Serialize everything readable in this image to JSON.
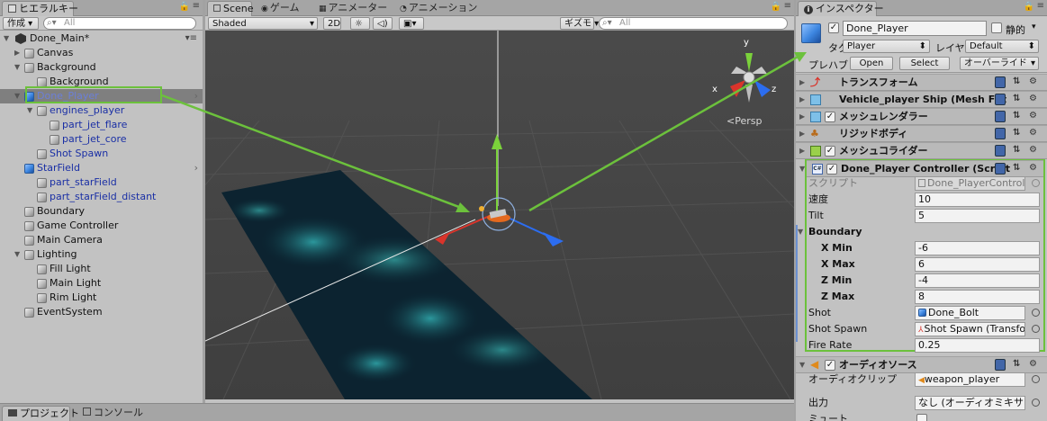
{
  "hierarchy": {
    "tab_label": "ヒエラルキー",
    "create_label": "作成 ▾",
    "search_placeholder": "All",
    "scene_name": "Done_Main*",
    "items": [
      {
        "label": "Canvas"
      },
      {
        "label": "Background"
      },
      {
        "label": "Background"
      },
      {
        "label": "Done_Player"
      },
      {
        "label": "engines_player"
      },
      {
        "label": "part_jet_flare"
      },
      {
        "label": "part_jet_core"
      },
      {
        "label": "Shot Spawn"
      },
      {
        "label": "StarField"
      },
      {
        "label": "part_starField"
      },
      {
        "label": "part_starField_distant"
      },
      {
        "label": "Boundary"
      },
      {
        "label": "Game Controller"
      },
      {
        "label": "Main Camera"
      },
      {
        "label": "Lighting"
      },
      {
        "label": "Fill Light"
      },
      {
        "label": "Main Light"
      },
      {
        "label": "Rim Light"
      },
      {
        "label": "EventSystem"
      }
    ]
  },
  "scene": {
    "tabs": [
      {
        "label": "Scene"
      },
      {
        "label": "ゲーム"
      },
      {
        "label": "アニメーター"
      },
      {
        "label": "アニメーション"
      }
    ],
    "shading_mode": "Shaded",
    "mode_2d": "2D",
    "gizmos_label": "ギズモ ▾",
    "search_placeholder": "All",
    "persp_label": "<Persp",
    "axis_x": "x",
    "axis_y": "y",
    "axis_z": "z"
  },
  "bottom": {
    "tabs": [
      {
        "label": "プロジェクト"
      },
      {
        "label": "コンソール"
      }
    ]
  },
  "inspector": {
    "tab_label": "インスペクター",
    "object_name": "Done_Player",
    "static_label": "静的",
    "tag_label": "タグ",
    "tag_value": "Player",
    "layer_label": "レイヤー",
    "layer_value": "Default",
    "prefab_label": "プレハブ",
    "open_label": "Open",
    "select_label": "Select",
    "override_label": "オーバーライド",
    "components": [
      {
        "label": "トランスフォーム"
      },
      {
        "label": "Vehicle_player Ship (Mesh Filt"
      },
      {
        "label": "メッシュレンダラー"
      },
      {
        "label": "リジッドボディ"
      },
      {
        "label": "メッシュコライダー"
      },
      {
        "label": "Done_Player Controller (Script"
      },
      {
        "label": "オーディオソース"
      }
    ],
    "script": {
      "script_label": "スクリプト",
      "script_value": "Done_PlayerControlle",
      "speed_label": "速度",
      "speed_value": "10",
      "tilt_label": "Tilt",
      "tilt_value": "5",
      "boundary_label": "Boundary",
      "xmin_label": "X Min",
      "xmin_value": "-6",
      "xmax_label": "X Max",
      "xmax_value": "6",
      "zmin_label": "Z Min",
      "zmin_value": "-4",
      "zmax_label": "Z Max",
      "zmax_value": "8",
      "shot_label": "Shot",
      "shot_value": "Done_Bolt",
      "spawn_label": "Shot Spawn",
      "spawn_value": "Shot Spawn (Transfor",
      "firerate_label": "Fire Rate",
      "firerate_value": "0.25"
    },
    "audio": {
      "clip_label": "オーディオクリップ",
      "clip_value": "weapon_player",
      "output_label": "出力",
      "output_value": "なし (オーディオミキサーグルー",
      "mute_label": "ミュート"
    }
  },
  "colors": {
    "highlight_green": "#6cc13c",
    "gizmo_y": "#7bd23b",
    "gizmo_x": "#d9342b",
    "gizmo_z": "#2c6df0",
    "selection_text": "#6b7fd8"
  }
}
